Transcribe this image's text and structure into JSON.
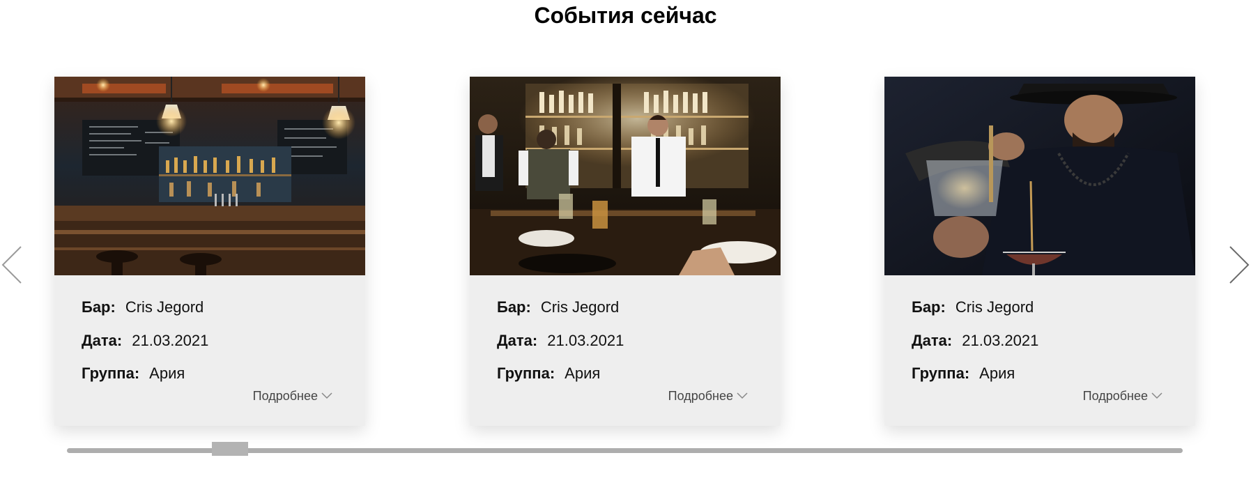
{
  "section": {
    "title": "События сейчас"
  },
  "labels": {
    "bar": "Бар:",
    "date": "Дата:",
    "group": "Группа:",
    "more": "Подробнее"
  },
  "events": [
    {
      "bar": "Cris Jegord",
      "date": "21.03.2021",
      "group": "Ария"
    },
    {
      "bar": "Cris Jegord",
      "date": "21.03.2021",
      "group": "Ария"
    },
    {
      "bar": "Cris Jegord",
      "date": "21.03.2021",
      "group": "Ария"
    }
  ],
  "icons": {
    "prev": "chevron-left-icon",
    "next": "chevron-right-icon",
    "more": "chevron-down-icon"
  },
  "colors": {
    "card_background": "#eeeeee",
    "scrollbar": "#adadad",
    "arrow": "#9a9a9a"
  }
}
